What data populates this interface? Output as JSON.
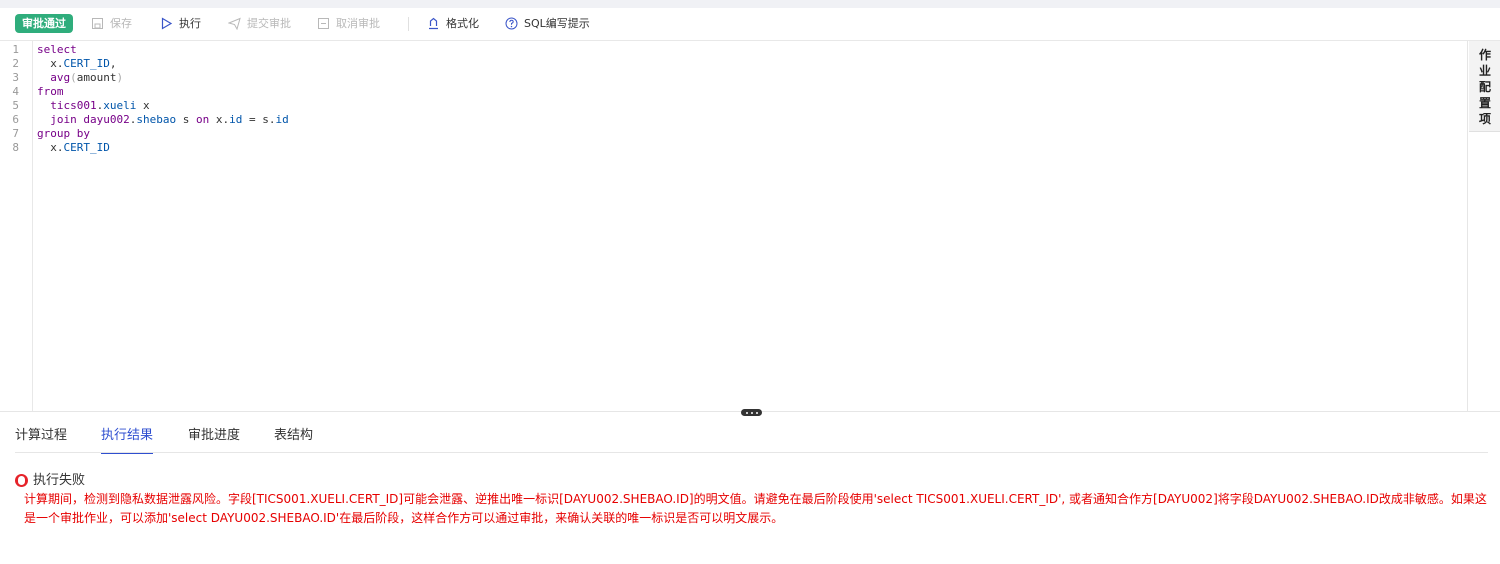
{
  "toolbar": {
    "status_badge": "审批通过",
    "save": "保存",
    "execute": "执行",
    "submit_approval": "提交审批",
    "cancel_approval": "取消审批",
    "format": "格式化",
    "sql_hint": "SQL编写提示"
  },
  "editor": {
    "line_numbers": [
      "1",
      "2",
      "3",
      "4",
      "5",
      "6",
      "7",
      "8"
    ]
  },
  "side_panel": {
    "label": "作业配置项"
  },
  "tabs": {
    "calc_process": "计算过程",
    "exec_result": "执行结果",
    "approval_progress": "审批进度",
    "table_structure": "表结构"
  },
  "result": {
    "status": "执行失败",
    "message": "计算期间，检测到隐私数据泄露风险。字段[TICS001.XUELI.CERT_ID]可能会泄露、逆推出唯一标识[DAYU002.SHEBAO.ID]的明文值。请避免在最后阶段使用'select TICS001.XUELI.CERT_ID', 或者通知合作方[DAYU002]将字段DAYU002.SHEBAO.ID改成非敏感。如果这是一个审批作业，可以添加'select DAYU002.SHEBAO.ID'在最后阶段，这样合作方可以通过审批，来确认关联的唯一标识是否可以明文展示。"
  },
  "colors": {
    "badge": "#2fad7c",
    "active_tab": "#2f4fd0",
    "error": "#e60000",
    "keyword": "#770088",
    "property": "#0055aa"
  }
}
